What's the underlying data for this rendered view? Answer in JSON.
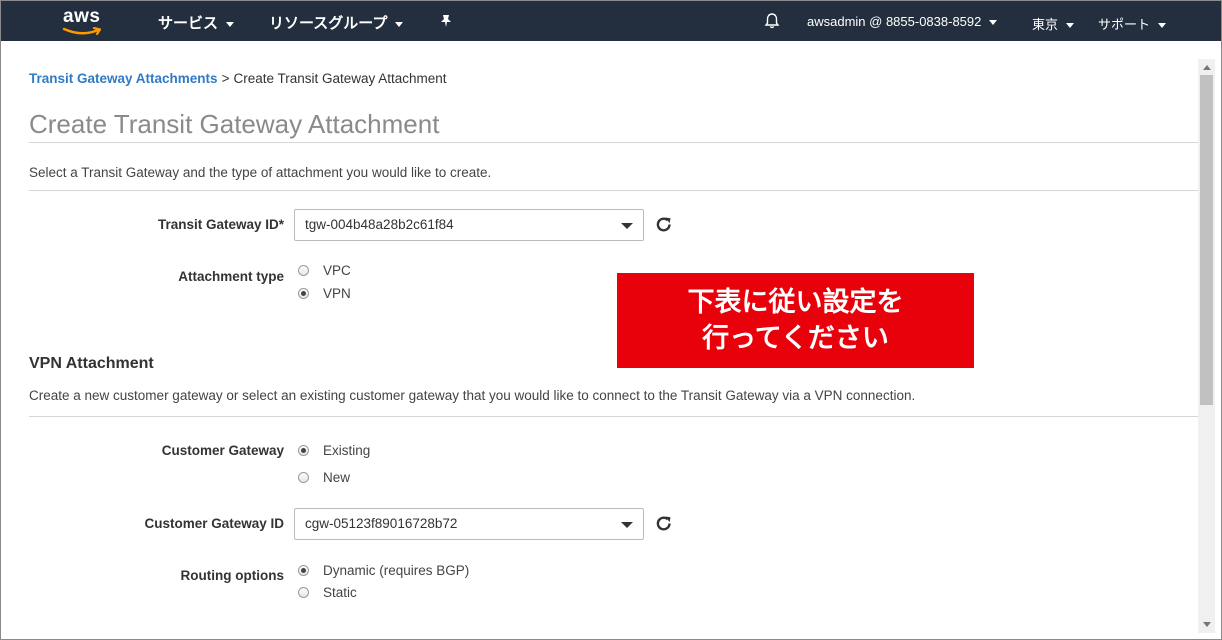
{
  "topnav": {
    "logo_text": "aws",
    "services": "サービス",
    "resource_groups": "リソースグループ",
    "account": "awsadmin @ 8855-0838-8592",
    "region": "東京",
    "support": "サポート"
  },
  "breadcrumb": {
    "parent": "Transit Gateway Attachments",
    "separator": ">",
    "current": "Create Transit Gateway Attachment"
  },
  "page": {
    "title": "Create Transit Gateway Attachment",
    "description": "Select a Transit Gateway and the type of attachment you would like to create."
  },
  "form": {
    "tgw_label": "Transit Gateway ID*",
    "tgw_value": "tgw-004b48a28b2c61f84",
    "attachment_type_label": "Attachment type",
    "attachment_options": [
      "VPC",
      "VPN"
    ],
    "attachment_selected": "VPN"
  },
  "vpn": {
    "title": "VPN Attachment",
    "description": "Create a new customer gateway or select an existing customer gateway that you would like to connect to the Transit Gateway via a VPN connection.",
    "cgw_label": "Customer Gateway",
    "cgw_options": [
      "Existing",
      "New"
    ],
    "cgw_selected": "Existing",
    "cgw_id_label": "Customer Gateway ID",
    "cgw_id_value": "cgw-05123f89016728b72",
    "routing_label": "Routing options",
    "routing_options": [
      "Dynamic (requires BGP)",
      "Static"
    ],
    "routing_selected": "Dynamic (requires BGP)"
  },
  "banner": {
    "line1": "下表に従い設定を",
    "line2": "行ってください",
    "color": "#e8000b"
  },
  "colors": {
    "nav_bg": "#232f3e",
    "link": "#2f7bc6",
    "aws_orange": "#ff9900"
  }
}
